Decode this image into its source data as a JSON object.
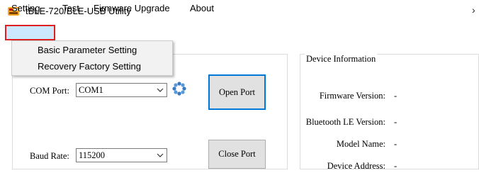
{
  "window": {
    "title": "tBLE-720/BLE-USB Utility",
    "app_icon": "icp-das-logo-icon",
    "chevron": "›"
  },
  "menu": {
    "setting": "Setting",
    "test": "Test",
    "firmware_upgrade": "Firmware Upgrade",
    "about": "About",
    "highlight_color": "#e02020"
  },
  "setting_menu": {
    "items": [
      "Basic Parameter Setting",
      "Recovery Factory Setting"
    ]
  },
  "connection": {
    "com_port_label": "COM Port:",
    "com_port_value": "COM1",
    "baud_rate_label": "Baud Rate:",
    "baud_rate_value": "115200",
    "open_port": "Open Port",
    "close_port": "Close Port",
    "refresh_icon": "refresh-icon",
    "accent_color": "#0078d7"
  },
  "device_info": {
    "title": "Device Information",
    "firmware_version_label": "Firmware Version:",
    "firmware_version_value": "-",
    "bluetooth_le_version_label": "Bluetooth LE Version:",
    "bluetooth_le_version_value": "-",
    "model_name_label": "Model Name:",
    "model_name_value": "-",
    "device_address_label": "Device Address:",
    "device_address_value": "-"
  }
}
